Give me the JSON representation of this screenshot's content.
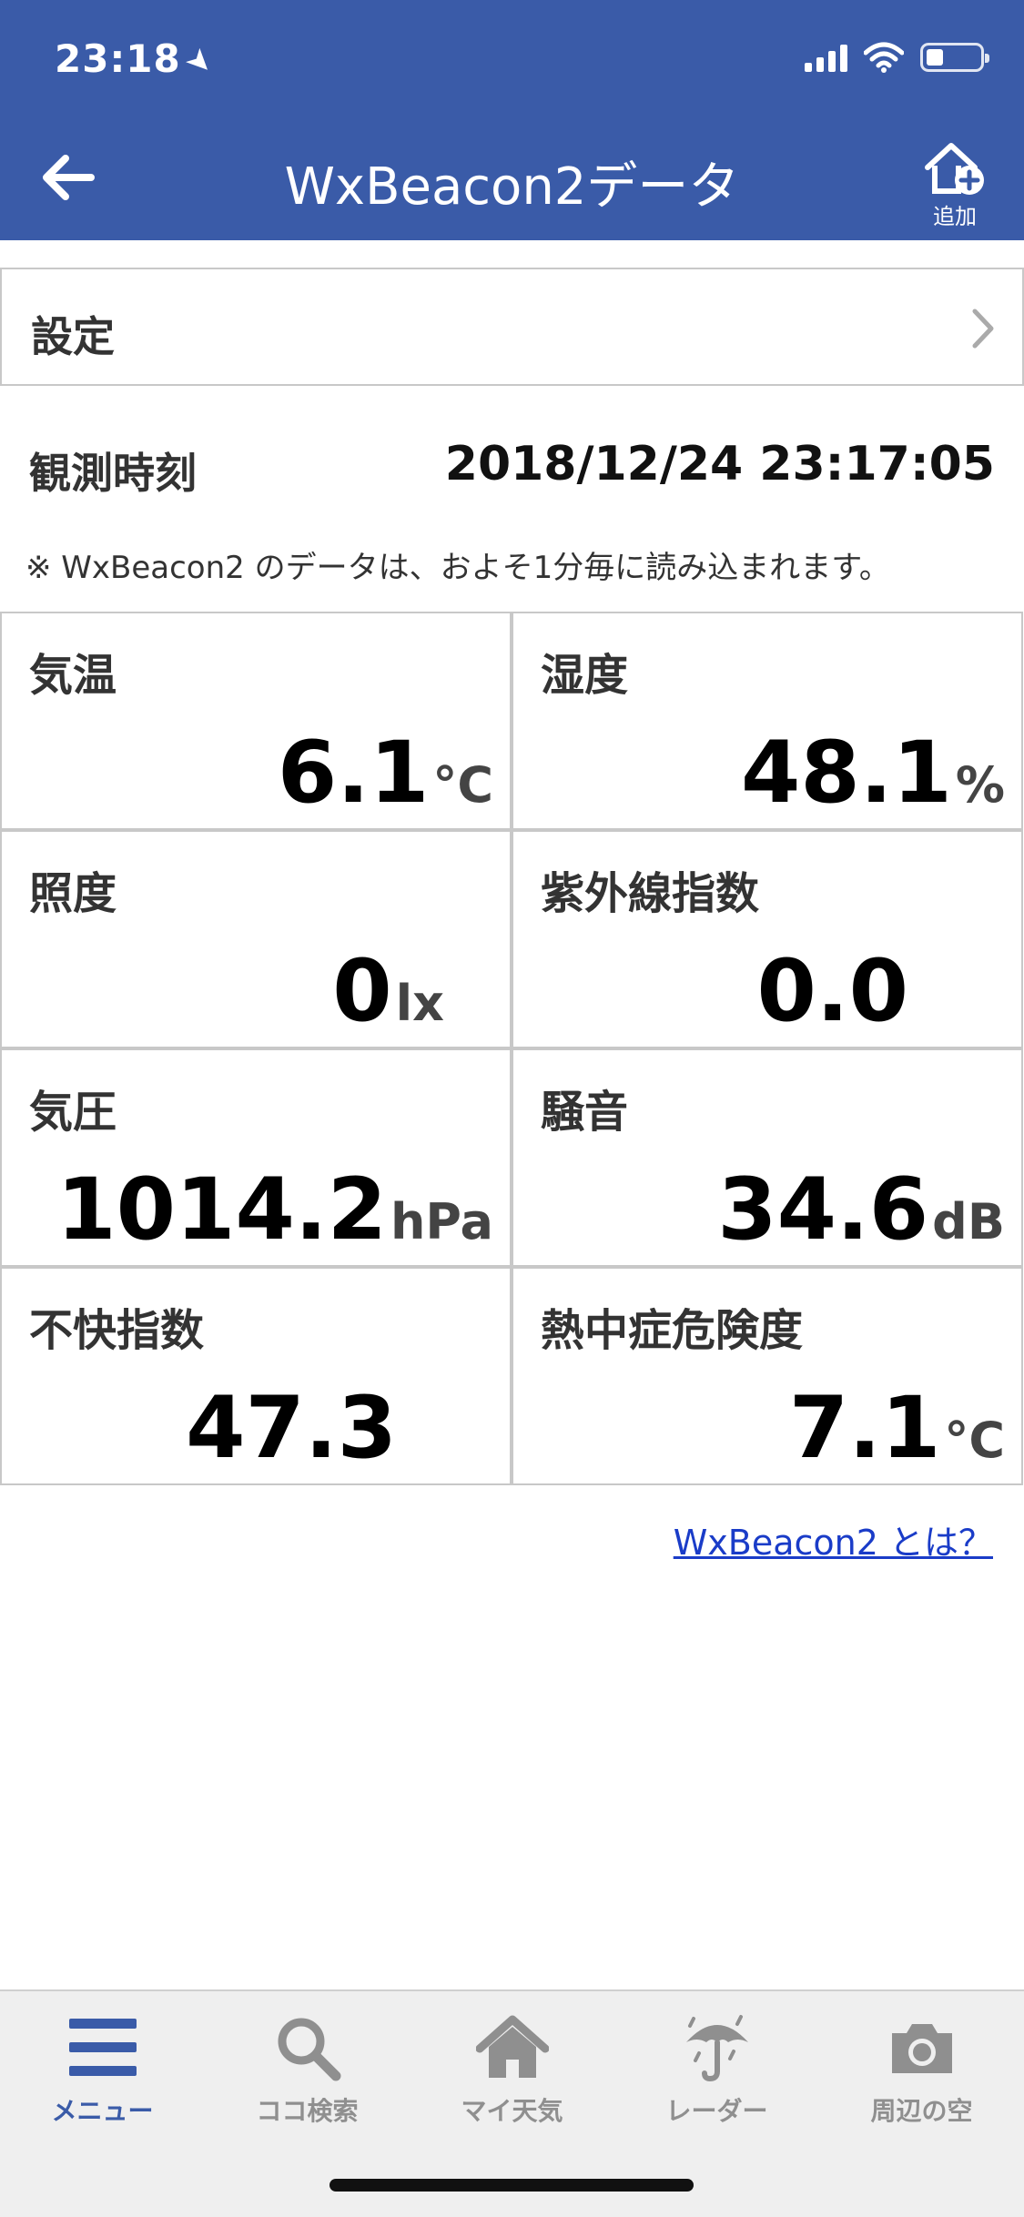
{
  "status": {
    "time": "23:18"
  },
  "header": {
    "title": "WxBeacon2データ",
    "add_label": "追加"
  },
  "settings": {
    "label": "設定"
  },
  "observation": {
    "label": "観測時刻",
    "value": "2018/12/24 23:17:05",
    "note": "※ WxBeacon2 のデータは、およそ1分毎に読み込まれます。"
  },
  "metrics": [
    {
      "name": "気温",
      "value": "6.1",
      "unit": "°C"
    },
    {
      "name": "湿度",
      "value": "48.1",
      "unit": "%"
    },
    {
      "name": "照度",
      "value": "0",
      "unit": "lx"
    },
    {
      "name": "紫外線指数",
      "value": "0.0",
      "unit": ""
    },
    {
      "name": "気圧",
      "value": "1014.2",
      "unit": "hPa"
    },
    {
      "name": "騒音",
      "value": "34.6",
      "unit": "dB"
    },
    {
      "name": "不快指数",
      "value": "47.3",
      "unit": ""
    },
    {
      "name": "熱中症危険度",
      "value": "7.1",
      "unit": "°C"
    }
  ],
  "about_link": "WxBeacon2 とは？",
  "tabs": [
    {
      "label": "メニュー",
      "icon": "menu-icon"
    },
    {
      "label": "ココ検索",
      "icon": "search-icon"
    },
    {
      "label": "マイ天気",
      "icon": "home-icon"
    },
    {
      "label": "レーダー",
      "icon": "umbrella-icon"
    },
    {
      "label": "周辺の空",
      "icon": "camera-icon"
    }
  ],
  "colors": {
    "header": "#3a5ba8",
    "link": "#1a3cc8",
    "tab_active": "#3a5ba8",
    "tab_inactive": "#8f8f8f"
  }
}
